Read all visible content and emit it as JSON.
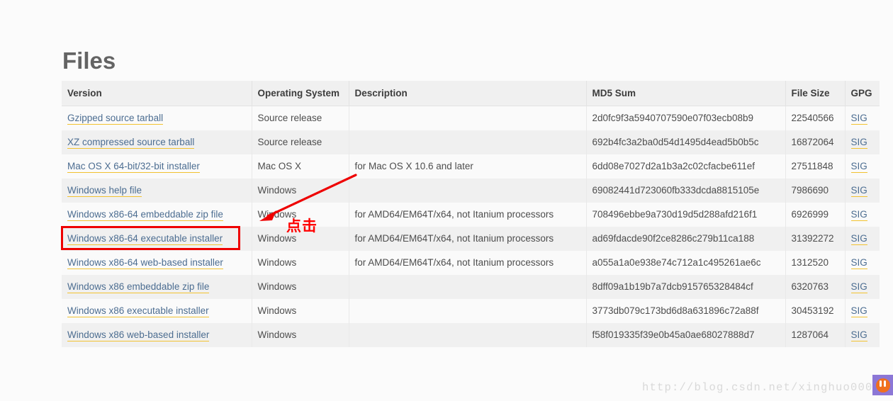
{
  "page": {
    "title": "Files",
    "background_color": "#fbfbfb"
  },
  "table": {
    "columns": [
      "Version",
      "Operating System",
      "Description",
      "MD5 Sum",
      "File Size",
      "GPG"
    ],
    "rows": [
      {
        "version": "Gzipped source tarball",
        "os": "Source release",
        "description": "",
        "md5": "2d0fc9f3a5940707590e07f03ecb08b9",
        "size": "22540566",
        "gpg": "SIG"
      },
      {
        "version": "XZ compressed source tarball",
        "os": "Source release",
        "description": "",
        "md5": "692b4fc3a2ba0d54d1495d4ead5b0b5c",
        "size": "16872064",
        "gpg": "SIG"
      },
      {
        "version": "Mac OS X 64-bit/32-bit installer",
        "os": "Mac OS X",
        "description": "for Mac OS X 10.6 and later",
        "md5": "6dd08e7027d2a1b3a2c02cfacbe611ef",
        "size": "27511848",
        "gpg": "SIG"
      },
      {
        "version": "Windows help file",
        "os": "Windows",
        "description": "",
        "md5": "69082441d723060fb333dcda8815105e",
        "size": "7986690",
        "gpg": "SIG"
      },
      {
        "version": "Windows x86-64 embeddable zip file",
        "os": "Windows",
        "description": "for AMD64/EM64T/x64, not Itanium processors",
        "md5": "708496ebbe9a730d19d5d288afd216f1",
        "size": "6926999",
        "gpg": "SIG"
      },
      {
        "version": "Windows x86-64 executable installer",
        "os": "Windows",
        "description": "for AMD64/EM64T/x64, not Itanium processors",
        "md5": "ad69fdacde90f2ce8286c279b11ca188",
        "size": "31392272",
        "gpg": "SIG"
      },
      {
        "version": "Windows x86-64 web-based installer",
        "os": "Windows",
        "description": "for AMD64/EM64T/x64, not Itanium processors",
        "md5": "a055a1a0e938e74c712a1c495261ae6c",
        "size": "1312520",
        "gpg": "SIG"
      },
      {
        "version": "Windows x86 embeddable zip file",
        "os": "Windows",
        "description": "",
        "md5": "8dff09a1b19b7a7dcb915765328484cf",
        "size": "6320763",
        "gpg": "SIG"
      },
      {
        "version": "Windows x86 executable installer",
        "os": "Windows",
        "description": "",
        "md5": "3773db079c173bd6d8a631896c72a88f",
        "size": "30453192",
        "gpg": "SIG"
      },
      {
        "version": "Windows x86 web-based installer",
        "os": "Windows",
        "description": "",
        "md5": "f58f019335f39e0b45a0ae68027888d7",
        "size": "1287064",
        "gpg": "SIG"
      }
    ]
  },
  "annotation": {
    "label": "点击",
    "color": "#ff0000",
    "highlighted_row_index": 5,
    "highlighted_row_label": "Windows x86-64 executable installer"
  },
  "watermark": {
    "text": "http://blog.csdn.net/xinghuo0007",
    "color": "#d9d9d9"
  },
  "colors": {
    "link": "#4c6d91",
    "link_underline": "#f2c230",
    "header_bg": "#f0f0f0",
    "row_odd_bg": "#fafafa",
    "row_even_bg": "#f0f0f0",
    "title": "#646464"
  }
}
